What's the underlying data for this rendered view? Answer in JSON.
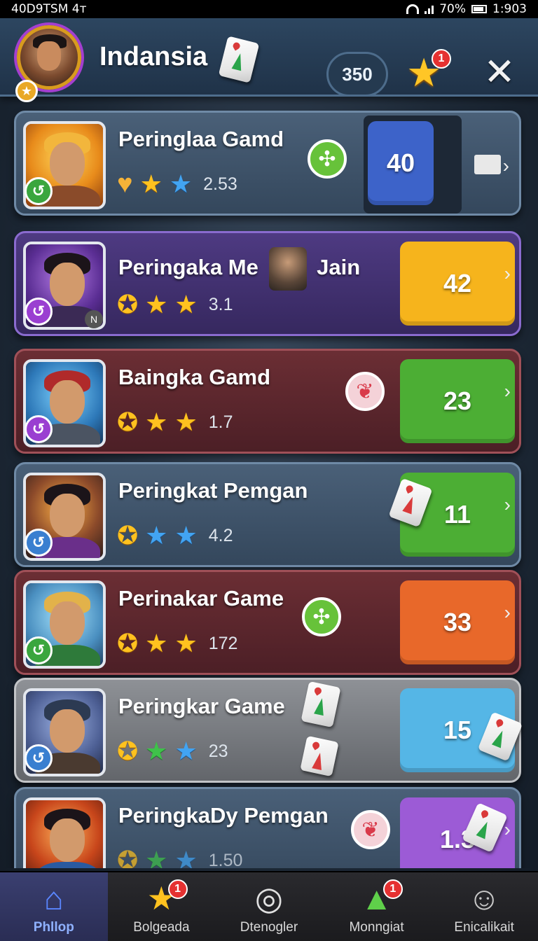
{
  "status_bar": {
    "left_text": "40D9TSM 4ᴛ",
    "battery": "70%",
    "time": "1:903"
  },
  "header": {
    "title": "Indansia",
    "coins": "350",
    "notifications": "1"
  },
  "games": [
    {
      "title": "Peringlaa Gamd",
      "rating": "2.53",
      "score": "40",
      "theme": "slate"
    },
    {
      "title": "Peringaka Me",
      "title_suffix": "Jain",
      "rating": "3.1",
      "score": "42",
      "theme": "purple",
      "portrait_tag": "N"
    },
    {
      "title": "Baingka Gamd",
      "rating": "1.7",
      "score": "23",
      "theme": "maroon"
    },
    {
      "title": "Peringkat Pemgan",
      "rating": "4.2",
      "score": "11",
      "theme": "slate"
    },
    {
      "title": "Perinakar Game",
      "rating": "172",
      "score": "33",
      "theme": "maroon"
    },
    {
      "title": "Peringkar Game",
      "rating": "23",
      "score": "15",
      "theme": "silver"
    },
    {
      "title": "PeringkaDy Pemgan",
      "rating": "1.50",
      "score": "1.3",
      "theme": "slate"
    }
  ],
  "nav": [
    {
      "label": "Phllop",
      "icon": "home-icon",
      "badge": ""
    },
    {
      "label": "Bolgeada",
      "icon": "star-icon",
      "badge": "1"
    },
    {
      "label": "Dtenogler",
      "icon": "search-icon",
      "badge": ""
    },
    {
      "label": "Monngiat",
      "icon": "gem-icon",
      "badge": "1"
    },
    {
      "label": "Enicalikait",
      "icon": "profile-icon",
      "badge": ""
    }
  ],
  "colors": {
    "score_blue": "#3d63c9",
    "score_yellow": "#f6b41c",
    "score_green": "#4cae34",
    "score_orange": "#e8682a",
    "score_sky": "#55b6e6",
    "score_violet": "#9c5bd6",
    "star_gold": "#ffc21f"
  }
}
